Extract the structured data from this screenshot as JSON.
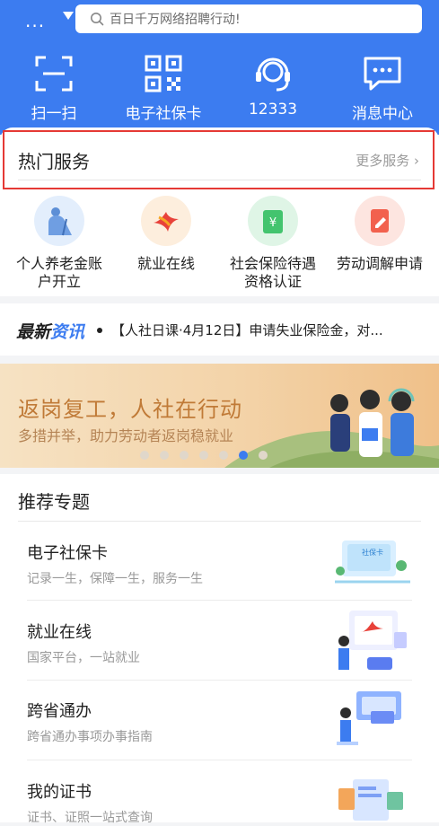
{
  "header": {
    "menu_label": "...",
    "search_placeholder": "百日千万网络招聘行动!",
    "quick_actions": [
      {
        "label": "扫一扫",
        "icon": "scan-icon"
      },
      {
        "label": "电子社保卡",
        "icon": "qrcode-icon"
      },
      {
        "label": "12333",
        "icon": "headset-icon"
      },
      {
        "label": "消息中心",
        "icon": "message-icon"
      }
    ]
  },
  "hot_services": {
    "title": "热门服务",
    "more": "更多服务 ›",
    "items": [
      {
        "label": "个人养老金账户开立",
        "icon": "elder-icon"
      },
      {
        "label": "就业在线",
        "icon": "employment-logo-icon"
      },
      {
        "label": "社会保险待遇资格认证",
        "icon": "wallet-icon"
      },
      {
        "label": "劳动调解申请",
        "icon": "document-pen-icon"
      }
    ]
  },
  "news": {
    "brand_prefix": "最新",
    "brand_suffix": "资讯",
    "text": "【人社日课·4月12日】申请失业保险金，对..."
  },
  "banner": {
    "title": "返岗复工，人社在行动",
    "subtitle": "多措并举，助力劳动者返岗稳就业",
    "slides": 7,
    "active_slide": 5
  },
  "topics": {
    "title": "推荐专题",
    "items": [
      {
        "title": "电子社保卡",
        "subtitle": "记录一生，保障一生，服务一生"
      },
      {
        "title": "就业在线",
        "subtitle": "国家平台，一站就业"
      },
      {
        "title": "跨省通办",
        "subtitle": "跨省通办事项办事指南"
      },
      {
        "title": "我的证书",
        "subtitle": "证书、证照一站式查询"
      }
    ]
  },
  "colors": {
    "brand_blue": "#3c7cf0",
    "highlight_red": "#e53935",
    "banner_text": "#c07a37"
  }
}
